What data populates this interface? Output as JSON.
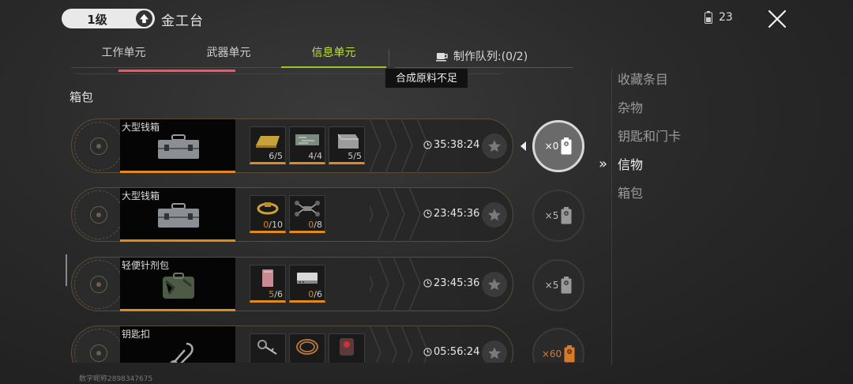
{
  "header": {
    "level_label": "1级",
    "station_title": "金工台",
    "resource_count": "23"
  },
  "tabs": [
    {
      "label": "工作单元",
      "active": false
    },
    {
      "label": "武器单元",
      "active": false
    },
    {
      "label": "信息单元",
      "active": true
    }
  ],
  "queue_label": "制作队列:(0/2)",
  "tooltip": "合成原料不足",
  "section_label": "箱包",
  "menu": [
    {
      "label": "收藏条目",
      "active": false
    },
    {
      "label": "杂物",
      "active": false
    },
    {
      "label": "钥匙和门卡",
      "active": false
    },
    {
      "label": "信物",
      "active": true
    },
    {
      "label": "箱包",
      "active": false
    }
  ],
  "rows": [
    {
      "name": "大型钱箱",
      "materials": [
        {
          "icon": "gold-bar-icon",
          "have": "6",
          "need": "5",
          "short": false
        },
        {
          "icon": "circuit-board-icon",
          "have": "4",
          "need": "4",
          "short": false
        },
        {
          "icon": "glass-cube-icon",
          "have": "5",
          "need": "5",
          "short": false
        }
      ],
      "time": "35:38:24",
      "craft_amount": "×0",
      "selected": true
    },
    {
      "name": "大型钱箱",
      "materials": [
        {
          "icon": "gold-ring-icon",
          "have": "0",
          "need": "10",
          "short": true
        },
        {
          "icon": "drone-icon",
          "have": "0",
          "need": "8",
          "short": true
        }
      ],
      "time": "23:45:36",
      "craft_amount": "×5",
      "selected": false
    },
    {
      "name": "轻便针剂包",
      "materials": [
        {
          "icon": "pink-card-icon",
          "have": "5",
          "need": "6",
          "short": true
        },
        {
          "icon": "device-icon",
          "have": "0",
          "need": "6",
          "short": true
        }
      ],
      "time": "23:45:36",
      "craft_amount": "×5",
      "selected": false
    },
    {
      "name": "钥匙扣",
      "materials": [
        {
          "icon": "keys-icon",
          "have": "",
          "need": "",
          "short": false
        },
        {
          "icon": "wire-coil-icon",
          "have": "",
          "need": "",
          "short": false
        },
        {
          "icon": "red-gadget-icon",
          "have": "",
          "need": "",
          "short": false
        }
      ],
      "time": "05:56:24",
      "craft_amount": "×60",
      "selected": false
    }
  ],
  "footer_id": "数字昵称2898347675",
  "colors": {
    "accent_green": "#bfe23a",
    "orange": "#e08a1e",
    "frame": "#5a4d36"
  }
}
